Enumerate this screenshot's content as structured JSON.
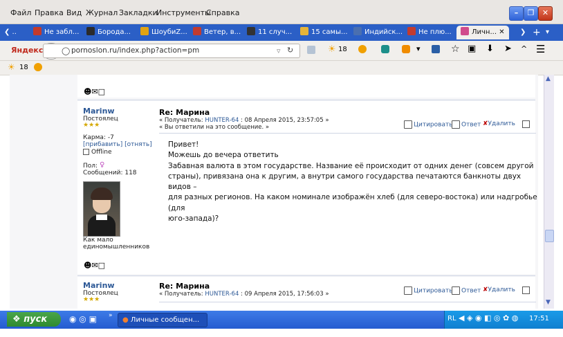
{
  "menu": [
    "Файл",
    "Правка",
    "Вид",
    "Журнал",
    "Закладки",
    "Инструменты",
    "Справка"
  ],
  "tabs": [
    {
      "label": "Не забл...",
      "color": "#c43a2b"
    },
    {
      "label": "Борода...",
      "color": "#2b2b2b"
    },
    {
      "label": "ШоубиZ...",
      "color": "#e0a313"
    },
    {
      "label": "Ветер, в...",
      "color": "#c23b2f"
    },
    {
      "label": "11 случ...",
      "color": "#333333"
    },
    {
      "label": "15 самы...",
      "color": "#e5b43a"
    },
    {
      "label": "Индийск...",
      "color": "#4a6fb0"
    },
    {
      "label": "Не плю...",
      "color": "#c23b2f"
    },
    {
      "label": "Личн...",
      "color": "#d04a8c"
    }
  ],
  "nav": {
    "brand": "Яндекс",
    "url": "pornoslon.ru/index.php?action=pm",
    "weather": "18"
  },
  "bookbar": {
    "weather": "18"
  },
  "post1": {
    "username": "Marinw",
    "status": "Постоялец",
    "karma": "Карма: -7",
    "karma_links": "[прибавить] [отнять]",
    "online": "Offline",
    "gender_label": "Пол:",
    "messages": "Сообщений: 118",
    "caption": "Как мало единомышленников",
    "subject": "Re: Марина",
    "meta_prefix": "« Получатель:",
    "recipient": "HUNTER-64",
    "meta_suffix": ": 08 Апреля 2015, 23:57:05 »",
    "meta2": "« Вы ответили на это сообщение. »",
    "quote": "Цитировать",
    "reply": "Ответ",
    "delete": "Удалить",
    "lines": [
      "Привет!",
      "Можешь до вечера ответить",
      "Забавная валюта в этом государстве. Название её происходит от одних денег (совсем другой",
      "страны), привязана она к другим, а внутри самого государства печатаются банкноты двух видов –",
      "для разных регионов. На каком номинале изображён хлеб (для северо-востока) или надгробье (для",
      "юго-запада)?"
    ]
  },
  "post2": {
    "username": "Marinw",
    "status": "Постоялец",
    "subject": "Re: Марина",
    "meta_prefix": "« Получатель:",
    "recipient": "HUNTER-64",
    "meta_suffix": ": 09 Апреля 2015, 17:56:03 »",
    "quote": "Цитировать",
    "reply": "Ответ",
    "delete": "Удалить"
  },
  "taskbar": {
    "start": "пуск",
    "task": "Личные сообщен...",
    "lang": "RL",
    "time": "17:51"
  }
}
